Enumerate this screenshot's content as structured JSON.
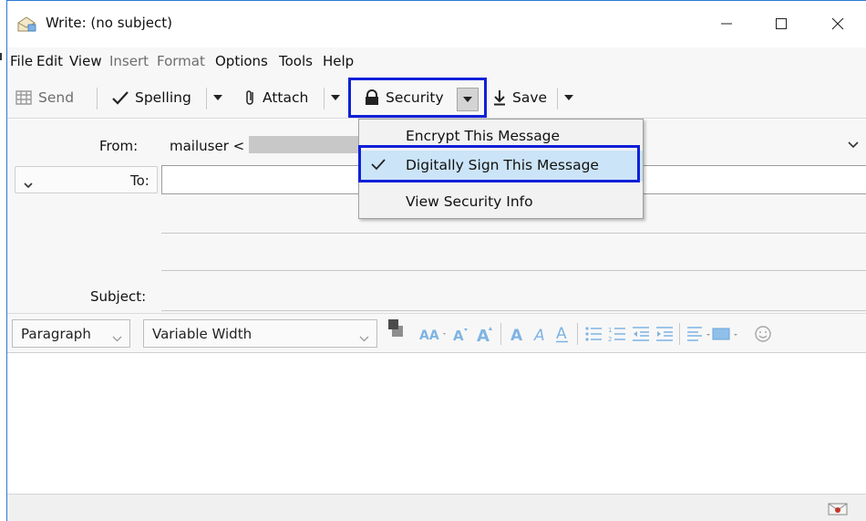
{
  "window": {
    "title": "Write: (no subject)"
  },
  "menubar": {
    "items": [
      {
        "label": "File",
        "disabled": false
      },
      {
        "label": "Edit",
        "disabled": false
      },
      {
        "label": "View",
        "disabled": false
      },
      {
        "label": "Insert",
        "disabled": true
      },
      {
        "label": "Format",
        "disabled": true
      },
      {
        "label": "Options",
        "disabled": false
      },
      {
        "label": "Tools",
        "disabled": false
      },
      {
        "label": "Help",
        "disabled": false
      }
    ]
  },
  "toolbar": {
    "send_label": "Send",
    "spelling_label": "Spelling",
    "attach_label": "Attach",
    "security_label": "Security",
    "save_label": "Save"
  },
  "headers": {
    "from_label": "From:",
    "from_value": "mailuser <",
    "to_label": "To:",
    "subject_label": "Subject:"
  },
  "format": {
    "paragraph_value": "Paragraph",
    "font_value": "Variable Width"
  },
  "security_menu": {
    "items": [
      {
        "label": "Encrypt This Message",
        "checked": false
      },
      {
        "label": "Digitally Sign This Message",
        "checked": true
      },
      {
        "label": "View Security Info",
        "checked": false
      }
    ]
  },
  "colors": {
    "highlight_border": "#1020d8",
    "checked_item_bg": "#cce4f7",
    "window_border": "#2b79d8"
  }
}
